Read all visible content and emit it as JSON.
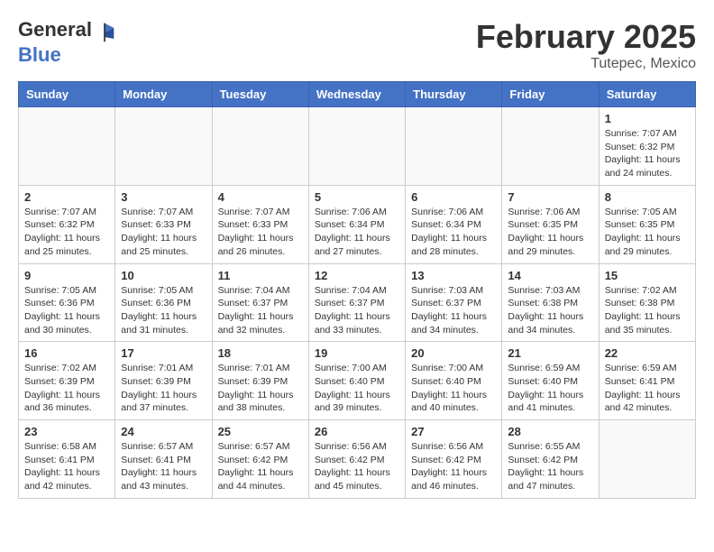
{
  "header": {
    "logo_general": "General",
    "logo_blue": "Blue",
    "month_year": "February 2025",
    "location": "Tutepec, Mexico"
  },
  "weekdays": [
    "Sunday",
    "Monday",
    "Tuesday",
    "Wednesday",
    "Thursday",
    "Friday",
    "Saturday"
  ],
  "weeks": [
    [
      {
        "day": "",
        "info": ""
      },
      {
        "day": "",
        "info": ""
      },
      {
        "day": "",
        "info": ""
      },
      {
        "day": "",
        "info": ""
      },
      {
        "day": "",
        "info": ""
      },
      {
        "day": "",
        "info": ""
      },
      {
        "day": "1",
        "info": "Sunrise: 7:07 AM\nSunset: 6:32 PM\nDaylight: 11 hours and 24 minutes."
      }
    ],
    [
      {
        "day": "2",
        "info": "Sunrise: 7:07 AM\nSunset: 6:32 PM\nDaylight: 11 hours and 25 minutes."
      },
      {
        "day": "3",
        "info": "Sunrise: 7:07 AM\nSunset: 6:33 PM\nDaylight: 11 hours and 25 minutes."
      },
      {
        "day": "4",
        "info": "Sunrise: 7:07 AM\nSunset: 6:33 PM\nDaylight: 11 hours and 26 minutes."
      },
      {
        "day": "5",
        "info": "Sunrise: 7:06 AM\nSunset: 6:34 PM\nDaylight: 11 hours and 27 minutes."
      },
      {
        "day": "6",
        "info": "Sunrise: 7:06 AM\nSunset: 6:34 PM\nDaylight: 11 hours and 28 minutes."
      },
      {
        "day": "7",
        "info": "Sunrise: 7:06 AM\nSunset: 6:35 PM\nDaylight: 11 hours and 29 minutes."
      },
      {
        "day": "8",
        "info": "Sunrise: 7:05 AM\nSunset: 6:35 PM\nDaylight: 11 hours and 29 minutes."
      }
    ],
    [
      {
        "day": "9",
        "info": "Sunrise: 7:05 AM\nSunset: 6:36 PM\nDaylight: 11 hours and 30 minutes."
      },
      {
        "day": "10",
        "info": "Sunrise: 7:05 AM\nSunset: 6:36 PM\nDaylight: 11 hours and 31 minutes."
      },
      {
        "day": "11",
        "info": "Sunrise: 7:04 AM\nSunset: 6:37 PM\nDaylight: 11 hours and 32 minutes."
      },
      {
        "day": "12",
        "info": "Sunrise: 7:04 AM\nSunset: 6:37 PM\nDaylight: 11 hours and 33 minutes."
      },
      {
        "day": "13",
        "info": "Sunrise: 7:03 AM\nSunset: 6:37 PM\nDaylight: 11 hours and 34 minutes."
      },
      {
        "day": "14",
        "info": "Sunrise: 7:03 AM\nSunset: 6:38 PM\nDaylight: 11 hours and 34 minutes."
      },
      {
        "day": "15",
        "info": "Sunrise: 7:02 AM\nSunset: 6:38 PM\nDaylight: 11 hours and 35 minutes."
      }
    ],
    [
      {
        "day": "16",
        "info": "Sunrise: 7:02 AM\nSunset: 6:39 PM\nDaylight: 11 hours and 36 minutes."
      },
      {
        "day": "17",
        "info": "Sunrise: 7:01 AM\nSunset: 6:39 PM\nDaylight: 11 hours and 37 minutes."
      },
      {
        "day": "18",
        "info": "Sunrise: 7:01 AM\nSunset: 6:39 PM\nDaylight: 11 hours and 38 minutes."
      },
      {
        "day": "19",
        "info": "Sunrise: 7:00 AM\nSunset: 6:40 PM\nDaylight: 11 hours and 39 minutes."
      },
      {
        "day": "20",
        "info": "Sunrise: 7:00 AM\nSunset: 6:40 PM\nDaylight: 11 hours and 40 minutes."
      },
      {
        "day": "21",
        "info": "Sunrise: 6:59 AM\nSunset: 6:40 PM\nDaylight: 11 hours and 41 minutes."
      },
      {
        "day": "22",
        "info": "Sunrise: 6:59 AM\nSunset: 6:41 PM\nDaylight: 11 hours and 42 minutes."
      }
    ],
    [
      {
        "day": "23",
        "info": "Sunrise: 6:58 AM\nSunset: 6:41 PM\nDaylight: 11 hours and 42 minutes."
      },
      {
        "day": "24",
        "info": "Sunrise: 6:57 AM\nSunset: 6:41 PM\nDaylight: 11 hours and 43 minutes."
      },
      {
        "day": "25",
        "info": "Sunrise: 6:57 AM\nSunset: 6:42 PM\nDaylight: 11 hours and 44 minutes."
      },
      {
        "day": "26",
        "info": "Sunrise: 6:56 AM\nSunset: 6:42 PM\nDaylight: 11 hours and 45 minutes."
      },
      {
        "day": "27",
        "info": "Sunrise: 6:56 AM\nSunset: 6:42 PM\nDaylight: 11 hours and 46 minutes."
      },
      {
        "day": "28",
        "info": "Sunrise: 6:55 AM\nSunset: 6:42 PM\nDaylight: 11 hours and 47 minutes."
      },
      {
        "day": "",
        "info": ""
      }
    ]
  ]
}
